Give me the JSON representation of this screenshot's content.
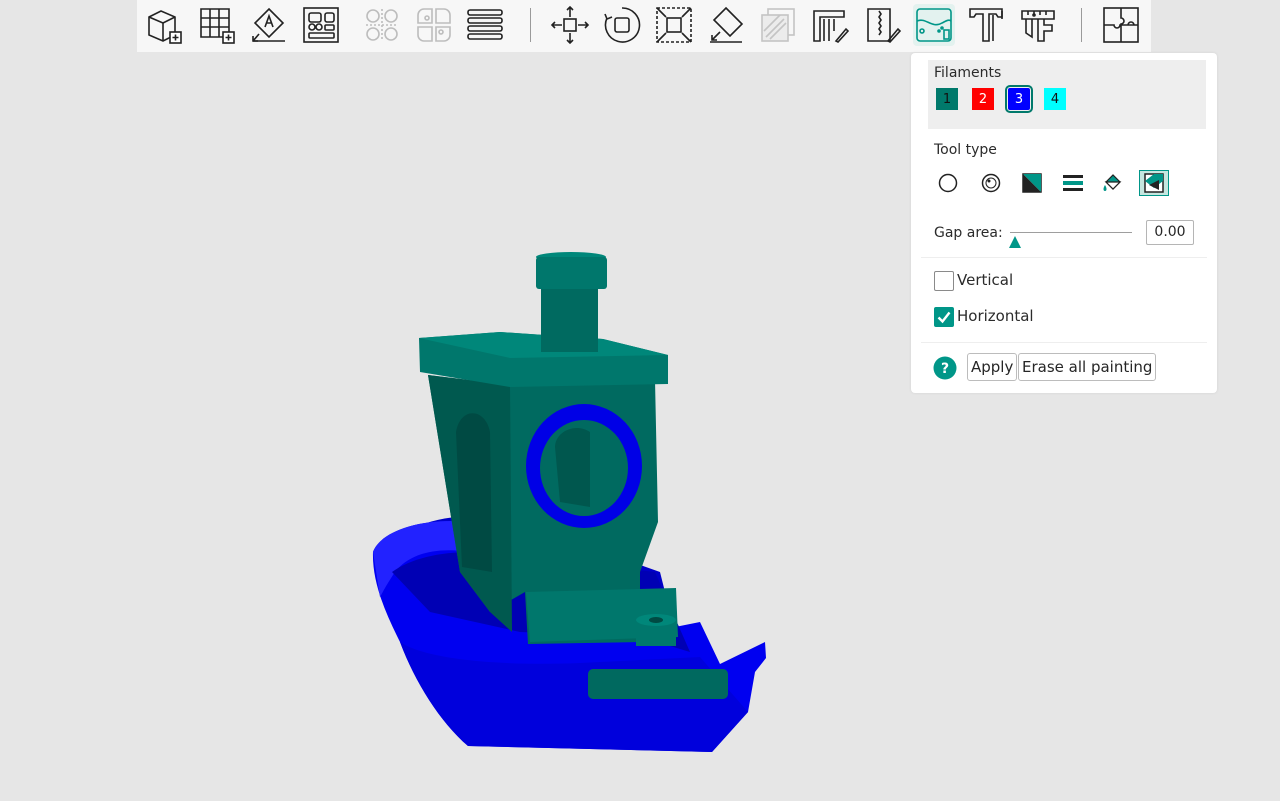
{
  "toolbar": {
    "items": [
      {
        "icon": "add-cube-icon",
        "active": false,
        "disabled": false
      },
      {
        "icon": "add-plate-icon",
        "active": false,
        "disabled": false
      },
      {
        "icon": "auto-orient-icon",
        "active": false,
        "disabled": false
      },
      {
        "icon": "arrange-icon",
        "active": false,
        "disabled": false
      },
      {
        "icon": "split-to-objects-icon",
        "active": false,
        "disabled": true
      },
      {
        "icon": "split-to-parts-icon",
        "active": false,
        "disabled": true
      },
      {
        "icon": "layers-icon",
        "active": false,
        "disabled": false
      },
      {
        "icon": "move-icon",
        "active": false,
        "disabled": false
      },
      {
        "icon": "rotate-icon",
        "active": false,
        "disabled": false
      },
      {
        "icon": "scale-icon",
        "active": false,
        "disabled": false
      },
      {
        "icon": "place-on-face-icon",
        "active": false,
        "disabled": false
      },
      {
        "icon": "cut-icon",
        "active": false,
        "disabled": true
      },
      {
        "icon": "support-painting-icon",
        "active": false,
        "disabled": false
      },
      {
        "icon": "seam-painting-icon",
        "active": false,
        "disabled": false
      },
      {
        "icon": "color-painting-icon",
        "active": true,
        "disabled": false
      },
      {
        "icon": "text-icon",
        "active": false,
        "disabled": false
      },
      {
        "icon": "measure-icon",
        "active": false,
        "disabled": false
      },
      {
        "icon": "assembly-icon",
        "active": false,
        "disabled": false
      }
    ]
  },
  "panel": {
    "filaments_label": "Filaments",
    "filaments": [
      {
        "label": "1",
        "color": "#00796b",
        "text_color": "#111111",
        "selected": false
      },
      {
        "label": "2",
        "color": "#ff0000",
        "text_color": "#ffffff",
        "selected": false
      },
      {
        "label": "3",
        "color": "#0000ff",
        "text_color": "#ffffff",
        "selected": true
      },
      {
        "label": "4",
        "color": "#00ffff",
        "text_color": "#111111",
        "selected": false
      }
    ],
    "tool_type_label": "Tool type",
    "tools": [
      {
        "icon": "circle-brush-icon",
        "active": false
      },
      {
        "icon": "sphere-brush-icon",
        "active": false
      },
      {
        "icon": "triangle-fill-icon",
        "active": false
      },
      {
        "icon": "height-range-icon",
        "active": false
      },
      {
        "icon": "bucket-fill-icon",
        "active": false
      },
      {
        "icon": "gap-fill-icon",
        "active": true
      }
    ],
    "gap_area_label": "Gap area:",
    "gap_area_value": "0.00",
    "gap_area_fraction": 0.0,
    "vertical_label": "Vertical",
    "vertical_checked": false,
    "horizontal_label": "Horizontal",
    "horizontal_checked": true,
    "apply_label": "Apply",
    "erase_label": "Erase all painting"
  },
  "colors": {
    "accent": "#009688",
    "body_painted": "#00695f",
    "hull_painted": "#0000ff"
  }
}
